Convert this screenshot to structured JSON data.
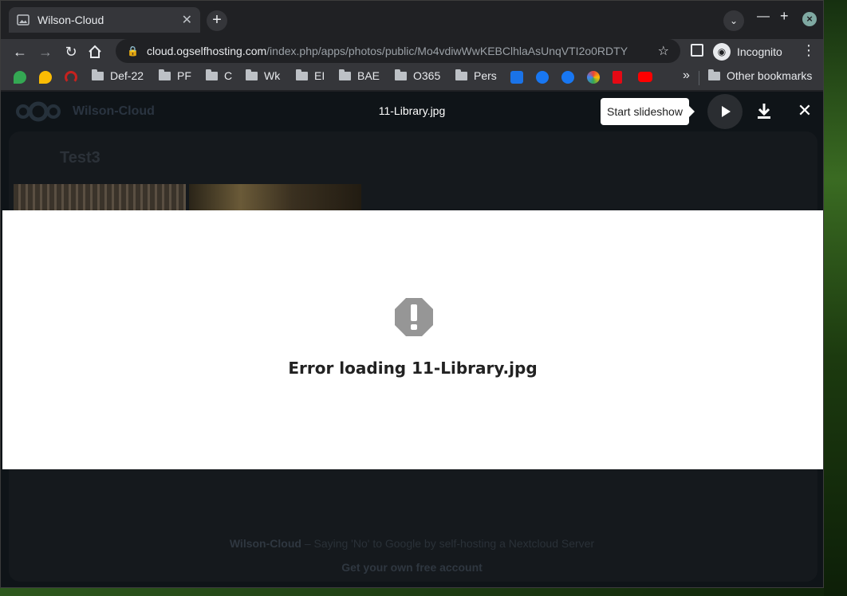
{
  "browser": {
    "tab_title": "Wilson-Cloud",
    "url_host": "cloud.ogselfhosting.com",
    "url_path": "/index.php/apps/photos/public/Mo4vdiwWwKEBClhlaAsUnqVTI2o0RDTY",
    "profile_label": "Incognito"
  },
  "bookmarks": {
    "items": [
      "Def-22",
      "PF",
      "C",
      "Wk",
      "EI",
      "BAE",
      "O365",
      "Pers"
    ],
    "overflow": "»",
    "other": "Other bookmarks"
  },
  "nextcloud": {
    "instance_name": "Wilson-Cloud",
    "album_title": "Test3",
    "footer_name": "Wilson-Cloud",
    "footer_tagline": "– Saying 'No' to Google by self-hosting a Nextcloud Server",
    "footer_cta": "Get your own free account"
  },
  "viewer": {
    "file_name": "11-Library.jpg",
    "tooltip": "Start slideshow",
    "error_message": "Error loading 11-Library.jpg"
  },
  "colors": {
    "chrome_dark": "#202124",
    "chrome_toolbar": "#35363a",
    "accent_close": "#7fa9a2",
    "error_icon": "#969696"
  }
}
